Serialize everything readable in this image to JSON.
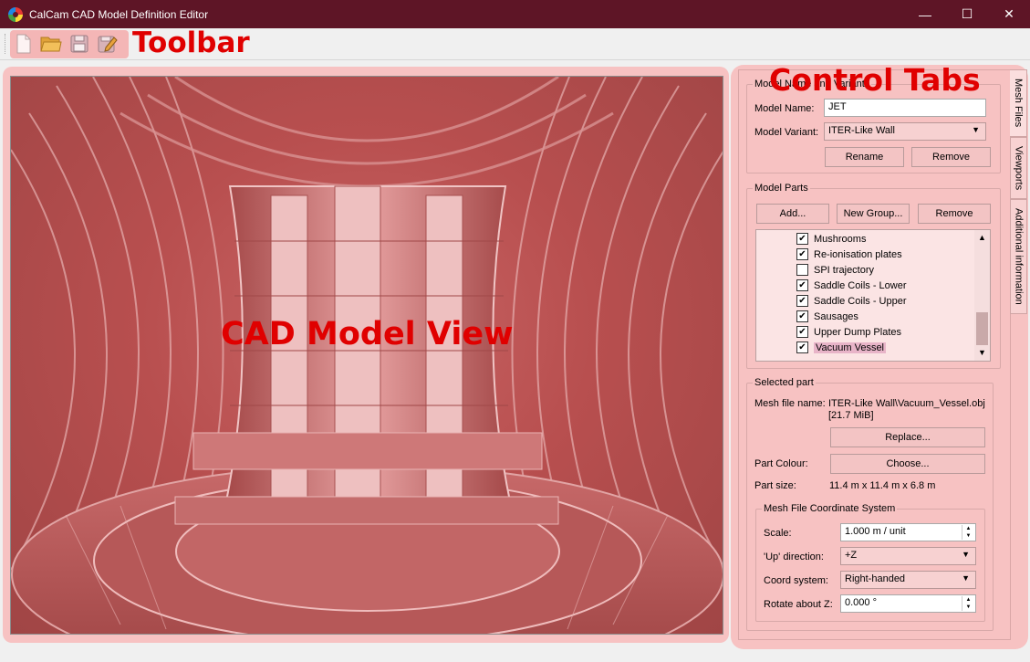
{
  "window": {
    "title": "CalCam CAD Model Definition Editor",
    "minimize": "—",
    "maximize": "☐",
    "close": "✕"
  },
  "toolbar": {
    "overlay_label": "Toolbar",
    "buttons": [
      "new-icon",
      "open-icon",
      "save-icon",
      "save-as-icon"
    ]
  },
  "cad_view": {
    "overlay_label": "CAD Model View"
  },
  "control_tabs": {
    "overlay_label": "Control Tabs",
    "tabs": [
      "Mesh Files",
      "Viewports",
      "Additional information"
    ],
    "model_group": {
      "title": "Model Name and Variants",
      "name_label": "Model Name:",
      "name_value": "JET",
      "variant_label": "Model Variant:",
      "variant_value": "ITER-Like Wall",
      "rename": "Rename",
      "remove": "Remove"
    },
    "parts_group": {
      "title": "Model Parts",
      "add": "Add...",
      "new_group": "New Group...",
      "remove": "Remove",
      "items": [
        {
          "label": "Mushrooms",
          "checked": true
        },
        {
          "label": "Re-ionisation plates",
          "checked": true
        },
        {
          "label": "SPI trajectory",
          "checked": false
        },
        {
          "label": "Saddle Coils - Lower",
          "checked": true
        },
        {
          "label": "Saddle Coils - Upper",
          "checked": true
        },
        {
          "label": "Sausages",
          "checked": true
        },
        {
          "label": "Upper Dump Plates",
          "checked": true
        },
        {
          "label": "Vacuum Vessel",
          "checked": true,
          "selected": true
        }
      ]
    },
    "selected_part": {
      "title": "Selected part",
      "mesh_label": "Mesh file name:",
      "mesh_value": "ITER-Like Wall\\Vacuum_Vessel.obj",
      "mesh_size": "[21.7 MiB]",
      "replace": "Replace...",
      "colour_label": "Part Colour:",
      "choose": "Choose...",
      "size_label": "Part size:",
      "size_value": "11.4 m x 11.4 m x 6.8 m",
      "coord_group": {
        "title": "Mesh File Coordinate System",
        "scale_label": "Scale:",
        "scale_value": "1.000 m / unit",
        "up_label": "'Up' direction:",
        "up_value": "+Z",
        "coord_label": "Coord system:",
        "coord_value": "Right-handed",
        "rotate_label": "Rotate about Z:",
        "rotate_value": "0.000 °"
      }
    }
  }
}
